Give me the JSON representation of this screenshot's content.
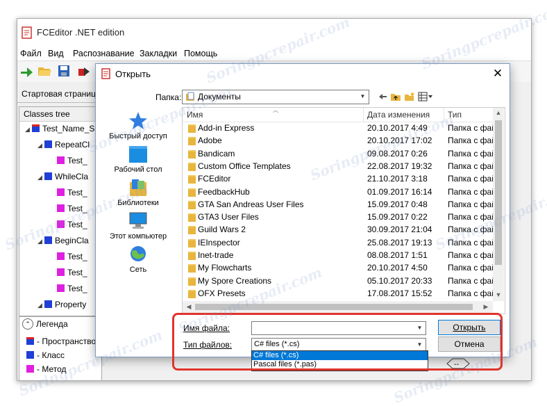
{
  "app": {
    "title": "FCEditor .NET edition",
    "menu": [
      "Файл",
      "Вид",
      "Распознавание",
      "Закладки",
      "Помощь"
    ],
    "start_tab": "Стартовая страница",
    "classes_tree": {
      "header": "Classes tree",
      "rows": [
        {
          "label": "Test_Name_S",
          "kind": "namespace",
          "indent": 0
        },
        {
          "label": "RepeatCl",
          "kind": "class",
          "indent": 1
        },
        {
          "label": "Test_",
          "kind": "method",
          "indent": 2
        },
        {
          "label": "WhileCla",
          "kind": "class",
          "indent": 1
        },
        {
          "label": "Test_",
          "kind": "method",
          "indent": 2
        },
        {
          "label": "Test_",
          "kind": "method",
          "indent": 2
        },
        {
          "label": "Test_",
          "kind": "method",
          "indent": 2
        },
        {
          "label": "BeginCla",
          "kind": "class",
          "indent": 1
        },
        {
          "label": "Test_",
          "kind": "method",
          "indent": 2
        },
        {
          "label": "Test_",
          "kind": "method",
          "indent": 2
        },
        {
          "label": "Test_",
          "kind": "method",
          "indent": 2
        },
        {
          "label": "Property",
          "kind": "class",
          "indent": 1
        }
      ]
    },
    "legend": {
      "title": "Легенда",
      "items": [
        "- Пространство",
        "- Класс",
        "- Метод"
      ]
    },
    "colors": {
      "namespace": "#1f3fd6",
      "class": "#1f3fd6",
      "method": "#e020e0"
    }
  },
  "dialog": {
    "title": "Открыть",
    "folder_label": "Папка:",
    "folder_value": "Документы",
    "places": [
      {
        "label": "Быстрый доступ",
        "icon": "star-icon"
      },
      {
        "label": "Рабочий стол",
        "icon": "desktop-icon"
      },
      {
        "label": "Библиотеки",
        "icon": "libraries-icon"
      },
      {
        "label": "Этот компьютер",
        "icon": "computer-icon"
      },
      {
        "label": "Сеть",
        "icon": "network-icon"
      }
    ],
    "columns": {
      "name": "Имя",
      "date": "Дата изменения",
      "type": "Тип"
    },
    "files": [
      {
        "name": "Add-in Express",
        "date": "20.10.2017 4:49",
        "type": "Папка с фай"
      },
      {
        "name": "Adobe",
        "date": "20.10.2017 17:02",
        "type": "Папка с фай"
      },
      {
        "name": "Bandicam",
        "date": "09.08.2017 0:26",
        "type": "Папка с фай"
      },
      {
        "name": "Custom Office Templates",
        "date": "22.08.2017 19:32",
        "type": "Папка с фай"
      },
      {
        "name": "FCEditor",
        "date": "21.10.2017 3:18",
        "type": "Папка с фай"
      },
      {
        "name": "FeedbackHub",
        "date": "01.09.2017 16:14",
        "type": "Папка с фай"
      },
      {
        "name": "GTA San Andreas User Files",
        "date": "15.09.2017 0:48",
        "type": "Папка с фай"
      },
      {
        "name": "GTA3 User Files",
        "date": "15.09.2017 0:22",
        "type": "Папка с фай"
      },
      {
        "name": "Guild Wars 2",
        "date": "30.09.2017 21:04",
        "type": "Папка с фай"
      },
      {
        "name": "IEInspector",
        "date": "25.08.2017 19:13",
        "type": "Папка с фай"
      },
      {
        "name": "Inet-trade",
        "date": "08.08.2017 1:51",
        "type": "Папка с фай"
      },
      {
        "name": "My Flowcharts",
        "date": "20.10.2017 4:50",
        "type": "Папка с фай"
      },
      {
        "name": "My Spore Creations",
        "date": "05.10.2017 20:33",
        "type": "Папка с фай"
      },
      {
        "name": "OFX Presets",
        "date": "17.08.2017 15:52",
        "type": "Папка с фай"
      }
    ],
    "filename_label": "Имя файла:",
    "filename_value": "",
    "filetype_label": "Тип файлов:",
    "filetype_value": "C# files (*.cs)",
    "filetype_options": [
      "C# files (*.cs)",
      "Pascal files (*.pas)"
    ],
    "open_button": "Открыть",
    "cancel_button": "Отмена",
    "highlight_color": "#e0342b"
  },
  "watermark": "Soringpcrepair.com"
}
